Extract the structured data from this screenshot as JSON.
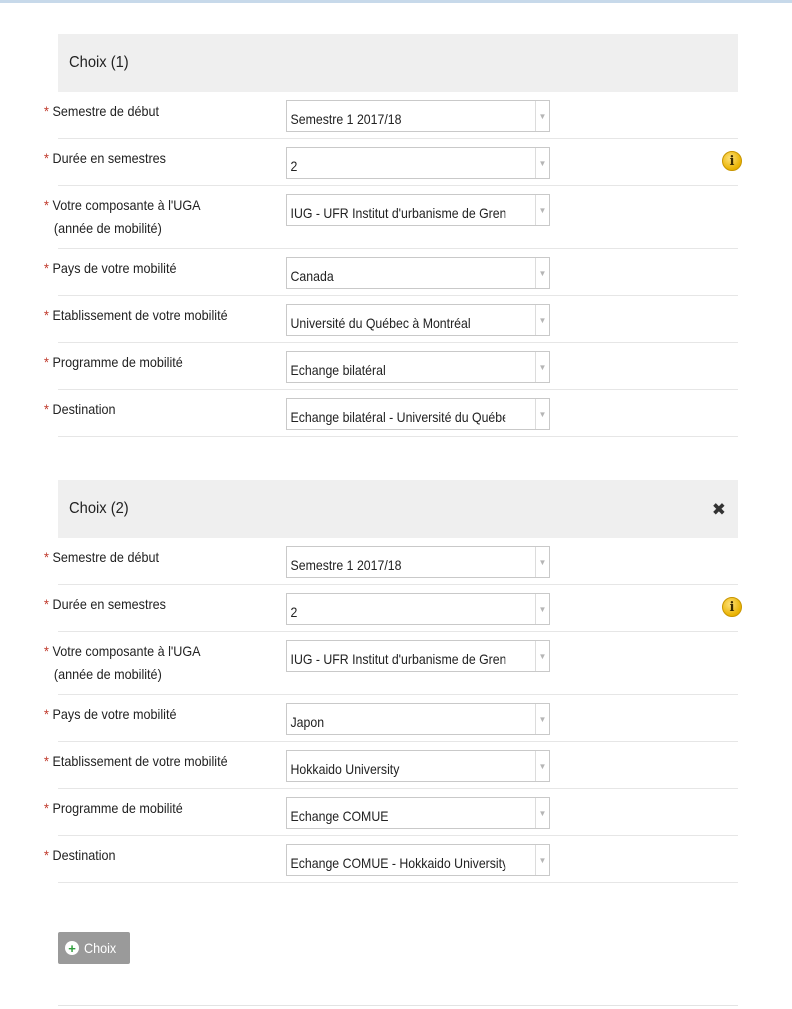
{
  "choices": [
    {
      "title": "Choix (1)",
      "closable": false,
      "fields": [
        {
          "label": "Semestre de début",
          "sub": "",
          "value": "Semestre 1 2017/18",
          "info": false
        },
        {
          "label": "Durée en semestres",
          "sub": "",
          "value": "2",
          "info": true
        },
        {
          "label": "Votre composante à l'UGA",
          "sub": "(année de mobilité)",
          "value": "IUG - UFR Institut d'urbanisme de Grenoble",
          "info": false
        },
        {
          "label": "Pays de votre mobilité",
          "sub": "",
          "value": "Canada",
          "info": false
        },
        {
          "label": "Etablissement de votre mobilité",
          "sub": "",
          "value": "Université du Québec à Montréal",
          "info": false
        },
        {
          "label": "Programme de mobilité",
          "sub": "",
          "value": "Echange bilatéral",
          "info": false
        },
        {
          "label": "Destination",
          "sub": "",
          "value": "Echange bilatéral - Université du Québec",
          "info": false
        }
      ]
    },
    {
      "title": "Choix (2)",
      "closable": true,
      "fields": [
        {
          "label": "Semestre de début",
          "sub": "",
          "value": "Semestre 1 2017/18",
          "info": false
        },
        {
          "label": "Durée en semestres",
          "sub": "",
          "value": "2",
          "info": true
        },
        {
          "label": "Votre composante à l'UGA",
          "sub": "(année de mobilité)",
          "value": "IUG - UFR Institut d'urbanisme de Grenoble",
          "info": false
        },
        {
          "label": "Pays de votre mobilité",
          "sub": "",
          "value": "Japon",
          "info": false
        },
        {
          "label": "Etablissement de votre mobilité",
          "sub": "",
          "value": "Hokkaido University",
          "info": false
        },
        {
          "label": "Programme de mobilité",
          "sub": "",
          "value": "Echange COMUE",
          "info": false
        },
        {
          "label": "Destination",
          "sub": "",
          "value": "Echange COMUE - Hokkaido University",
          "info": false
        }
      ]
    }
  ],
  "required_marker": "*",
  "info_glyph": "i",
  "close_glyph": "✖",
  "add_button": {
    "label": "Choix",
    "icon": "plus-icon"
  },
  "colors": {
    "header_bg": "#efefef",
    "required": "#c0392b",
    "info": "#e9b200",
    "button_bg": "#9a9a9a",
    "plus": "#2e9d3a"
  }
}
